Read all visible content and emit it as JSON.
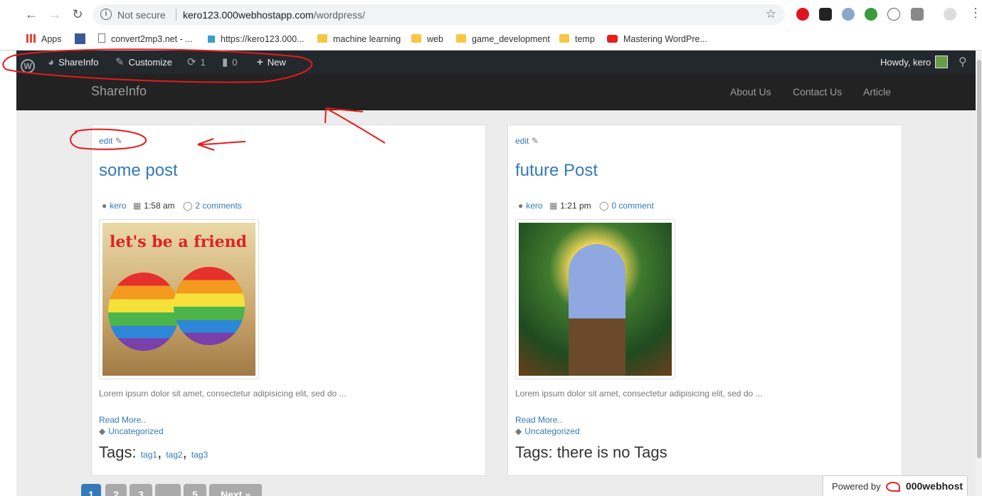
{
  "browser": {
    "security": "Not secure",
    "url_host": "kero123.000webhostapp.com",
    "url_path": "/wordpress/",
    "bookmarks": [
      "Apps",
      "convert2mp3.net - ...",
      "https://kero123.000...",
      "machine learning",
      "web",
      "game_development",
      "temp",
      "Mastering WordPre..."
    ]
  },
  "admin_bar": {
    "site": "ShareInfo",
    "customize": "Customize",
    "updates": "1",
    "comments": "0",
    "new": "New",
    "howdy": "Howdy, kero"
  },
  "site": {
    "brand": "ShareInfo",
    "nav": [
      "About Us",
      "Contact Us",
      "Article"
    ]
  },
  "posts": [
    {
      "edit": "edit",
      "title": "some post",
      "author": "kero",
      "time": "1:58 am",
      "comments": "2 comments",
      "image_text": "let's be a friend",
      "excerpt": "Lorem ipsum dolor sit amet, consectetur adipisicing elit, sed do ...",
      "read_more": "Read More..",
      "category": "Uncategorized",
      "tags_label": "Tags:",
      "tags": [
        "tag1",
        "tag2",
        "tag3"
      ]
    },
    {
      "edit": "edit",
      "title": "future Post",
      "author": "kero",
      "time": "1:21 pm",
      "comments": "0 comment",
      "excerpt": "Lorem ipsum dolor sit amet, consectetur adipisicing elit, sed do ...",
      "read_more": "Read More..",
      "category": "Uncategorized",
      "tags_label": "Tags: there is no Tags"
    }
  ],
  "pagination": [
    "1",
    "2",
    "3",
    "...",
    "5",
    "Next »"
  ],
  "footer": {
    "powered_by": "Powered by",
    "host": "000webhost"
  }
}
